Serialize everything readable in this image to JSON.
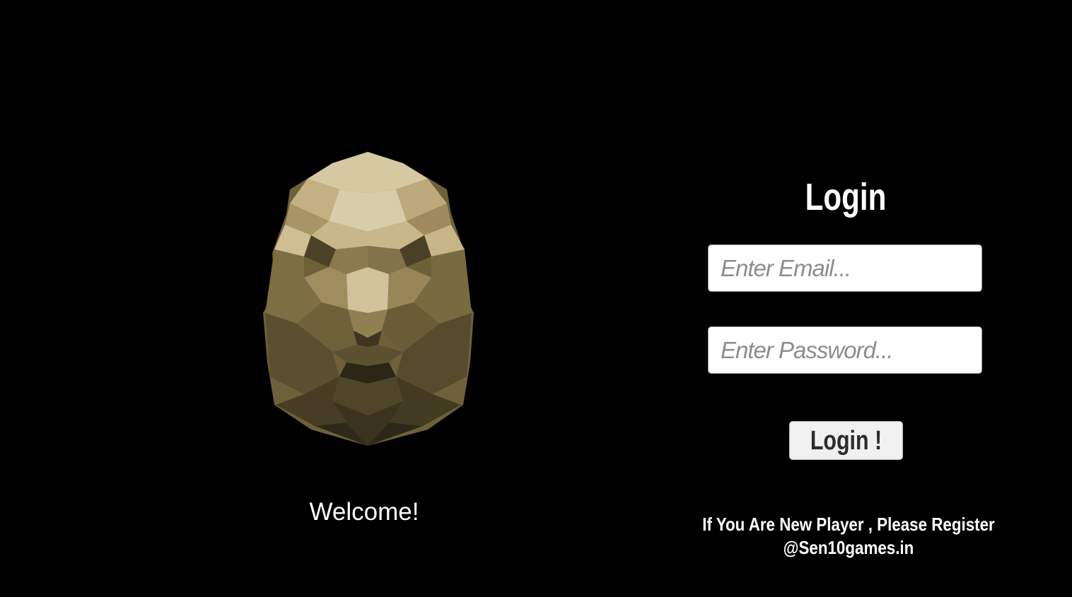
{
  "welcome": {
    "text": "Welcome!"
  },
  "logo": {
    "icon": "lion-head-icon",
    "color": "#b8a578"
  },
  "login_form": {
    "title": "Login",
    "email_placeholder": "Enter Email...",
    "password_placeholder": "Enter Password...",
    "submit_label": "Login !",
    "register_line1": "If You Are New Player , Please Register",
    "register_line2": "@Sen10games.in"
  },
  "colors": {
    "background": "#000000",
    "text": "#ffffff",
    "field_background": "#ffffff",
    "button_background": "#f0f0f0"
  }
}
